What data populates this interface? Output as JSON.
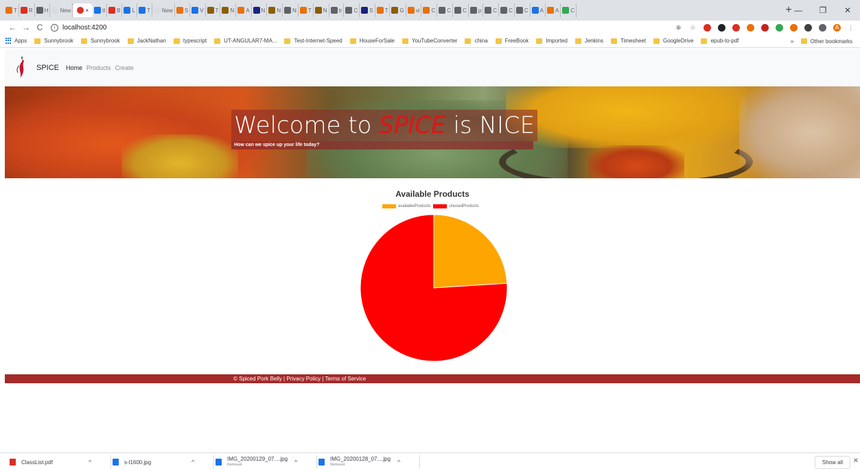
{
  "browser": {
    "tabs": [
      {
        "title": "T",
        "color": "#e8710a"
      },
      {
        "title": "R",
        "color": "#d93025"
      },
      {
        "title": "H",
        "color": "#5f6368"
      },
      {
        "title": "New",
        "color": "#dadce0"
      },
      {
        "title": "tl",
        "color": "#1a73e8"
      },
      {
        "title": "B",
        "color": "#d93025"
      },
      {
        "title": "L",
        "color": "#1a73e8"
      },
      {
        "title": "T",
        "color": "#1a73e8"
      },
      {
        "title": "New",
        "color": "#dadce0"
      },
      {
        "title": "S",
        "color": "#e8710a"
      },
      {
        "title": "V",
        "color": "#1a73e8"
      },
      {
        "title": "T",
        "color": "#8b5e00"
      },
      {
        "title": "N",
        "color": "#8b5e00"
      },
      {
        "title": "A",
        "color": "#e8710a"
      },
      {
        "title": "N",
        "color": "#1a237e"
      },
      {
        "title": "N",
        "color": "#8b5e00"
      },
      {
        "title": "N",
        "color": "#5f6368"
      },
      {
        "title": "T",
        "color": "#e8710a"
      },
      {
        "title": "N",
        "color": "#8b5e00"
      },
      {
        "title": "tr",
        "color": "#5f6368"
      },
      {
        "title": "C",
        "color": "#5f6368"
      },
      {
        "title": "S",
        "color": "#1a237e"
      },
      {
        "title": "T",
        "color": "#e8710a"
      },
      {
        "title": "G",
        "color": "#8b5e00"
      },
      {
        "title": "vi",
        "color": "#e8710a"
      },
      {
        "title": "C",
        "color": "#e8710a"
      },
      {
        "title": "C",
        "color": "#5f6368"
      },
      {
        "title": "C",
        "color": "#5f6368"
      },
      {
        "title": "p",
        "color": "#5f6368"
      },
      {
        "title": "C",
        "color": "#5f6368"
      },
      {
        "title": "C",
        "color": "#5f6368"
      },
      {
        "title": "C",
        "color": "#5f6368"
      },
      {
        "title": "A",
        "color": "#1a73e8"
      },
      {
        "title": "A",
        "color": "#e8710a"
      },
      {
        "title": "C",
        "color": "#34a853"
      }
    ],
    "active_tab_title": "×",
    "active_tab_color": "#d93025",
    "new_tab_symbol": "+",
    "window": {
      "minimize": "—",
      "restore": "❐",
      "close": "✕"
    },
    "nav": {
      "back": "←",
      "forward": "→",
      "reload": "C"
    },
    "address": "localhost:4200",
    "info_symbol": "i",
    "zoom_symbol": "⊕",
    "star_symbol": "☆",
    "extensions": [
      {
        "name": "red-ext-icon",
        "color": "#d93025"
      },
      {
        "name": "dark-ext-icon",
        "color": "#202124"
      },
      {
        "name": "pocket-ext-icon",
        "color": "#d93025"
      },
      {
        "name": "orange-ext-icon",
        "color": "#e8710a"
      },
      {
        "name": "red-ext-icon-2",
        "color": "#c5221f"
      },
      {
        "name": "green-ext-icon",
        "color": "#34a853"
      },
      {
        "name": "c-ext-icon",
        "color": "#e8710a"
      },
      {
        "name": "grey-ext-icon",
        "color": "#3c4043"
      },
      {
        "name": "cast-ext-icon",
        "color": "#5f6368"
      }
    ],
    "profile_initial": "A",
    "menu_symbol": "⋮",
    "bookmarks": [
      "Apps",
      "Sunnybrook",
      "Sunnybrook",
      "JackNathan",
      "typescript",
      "UT-ANGULAR7-MA...",
      "Test-Internet-Speed",
      "HouseForSale",
      "YouTubeConverter",
      "china",
      "FreeBook",
      "Imported",
      "Jenkins",
      "Timesheet",
      "GoogleDrive",
      "epub-to-pdf"
    ],
    "bookmarks_overflow": "»",
    "other_bookmarks": "Other bookmarks"
  },
  "app": {
    "brand": "SPICE",
    "nav": {
      "home": "Home",
      "products": "Products",
      "create": "Create"
    },
    "hero": {
      "title_prefix": "Welcome to",
      "title_emphasis": "SPICE",
      "title_suffix": "is NICE",
      "subtitle": "How can we spice up your life today?"
    },
    "footer": "© Spiced Pork Belly | Privacy Policy | Terms of Service"
  },
  "chart_data": {
    "type": "pie",
    "title": "Available Products",
    "labels": [
      "availableProducts",
      "unusedProducts"
    ],
    "values": [
      24,
      76
    ],
    "colors": [
      "#ffa500",
      "#ff0000"
    ],
    "legend": "top"
  },
  "downloads": {
    "items": [
      {
        "name": "ClassList.pdf",
        "status": "",
        "color": "#d93025"
      },
      {
        "name": "s-l1600.jpg",
        "status": "",
        "color": "#1a73e8"
      },
      {
        "name": "IMG_20200129_07....jpg",
        "status": "Removed",
        "color": "#1a73e8"
      },
      {
        "name": "IMG_20200128_07....jpg",
        "status": "Removed",
        "color": "#1a73e8"
      }
    ],
    "caret": "^",
    "show_all": "Show all",
    "close": "✕"
  }
}
